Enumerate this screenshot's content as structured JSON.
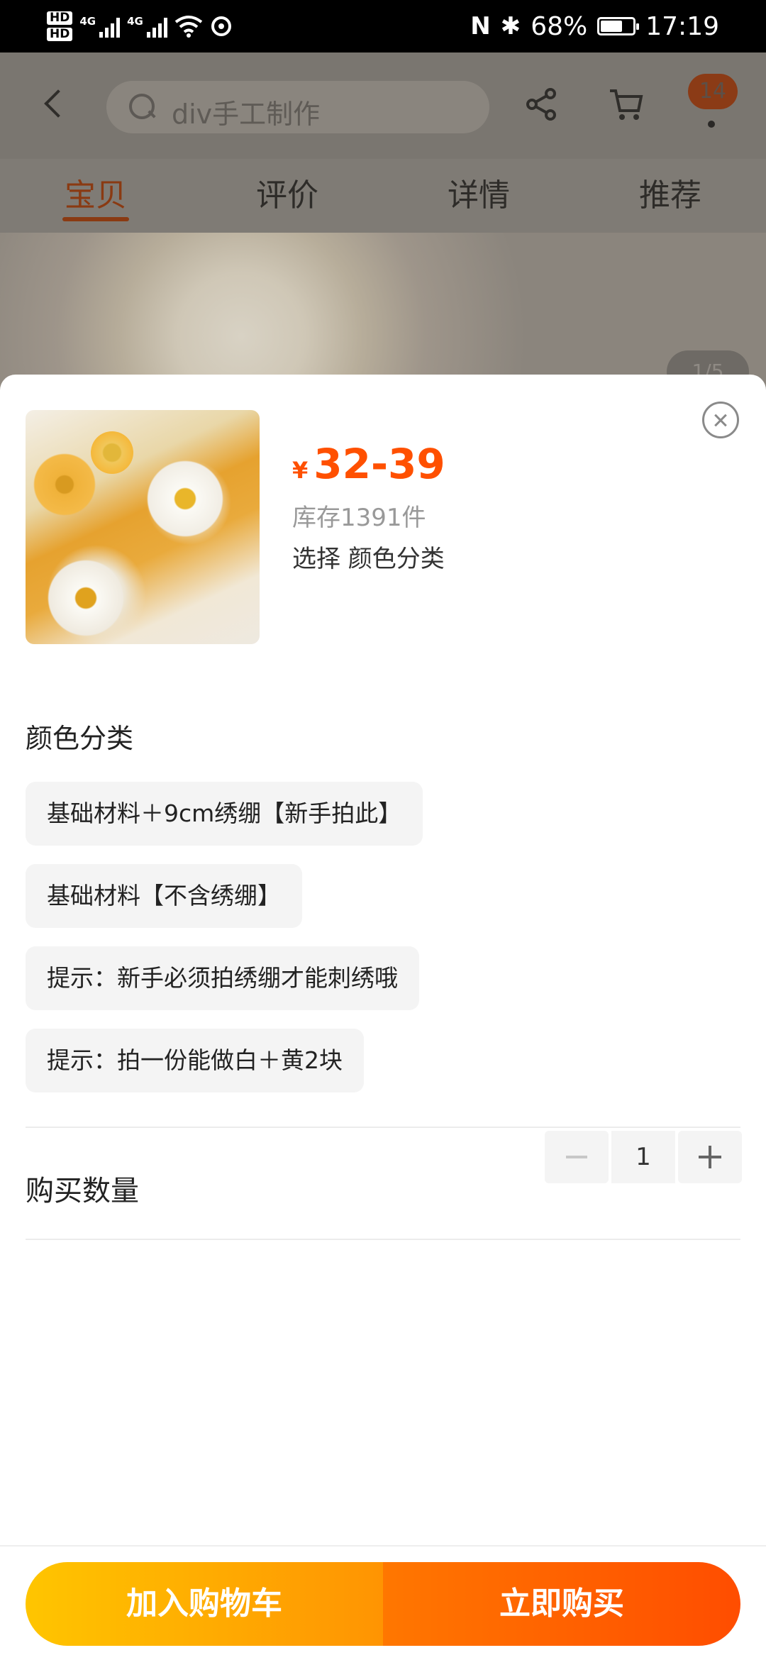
{
  "status_bar": {
    "hd1": "HD",
    "hd2": "HD",
    "net1": "4G",
    "net2": "4G",
    "battery_pct": "68%",
    "time": "17:19"
  },
  "header": {
    "search_placeholder": "div手工制作",
    "cart_badge": "14"
  },
  "tabs": [
    "宝贝",
    "评价",
    "详情",
    "推荐"
  ],
  "gallery": {
    "pager": "1/5"
  },
  "sku_sheet": {
    "price_currency": "¥",
    "price_range": "32-39",
    "stock": "库存1391件",
    "selected": "选择 颜色分类",
    "section_title": "颜色分类",
    "options": [
      "基础材料＋9cm绣绷【新手拍此】",
      "基础材料【不含绣绷】",
      "提示：新手必须拍绣绷才能刺绣哦",
      "提示：拍一份能做白＋黄2块"
    ],
    "quantity_label": "购买数量",
    "quantity_value": "1"
  },
  "actions": {
    "add_to_cart": "加入购物车",
    "buy_now": "立即购买"
  },
  "colors": {
    "accent": "#ff5000",
    "cart_button_start": "#ffc500",
    "buy_button_end": "#ff4d00"
  }
}
